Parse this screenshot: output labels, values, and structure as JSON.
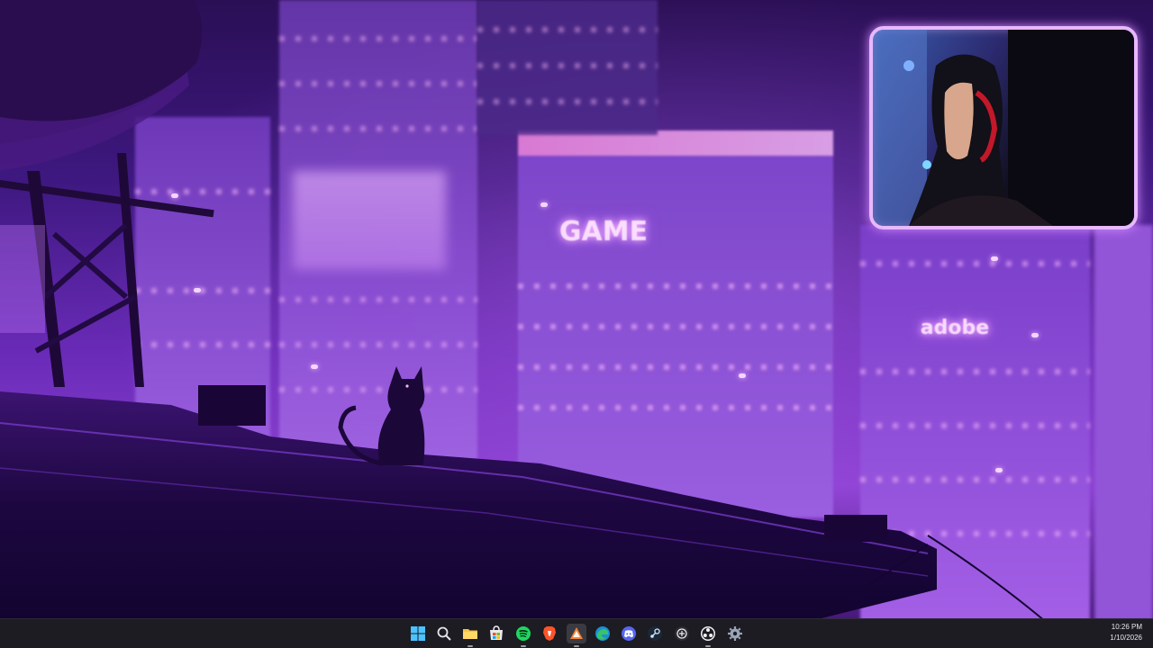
{
  "desktop": {
    "wallpaper_signs": {
      "game_sign": "GAME",
      "adobe_sign": "adobe"
    }
  },
  "webcam": {
    "label": "webcam-overlay"
  },
  "taskbar": {
    "icons": [
      {
        "name": "windows-start-icon",
        "label": "Start"
      },
      {
        "name": "search-icon",
        "label": "Search"
      },
      {
        "name": "file-explorer-icon",
        "label": "File Explorer"
      },
      {
        "name": "microsoft-store-icon",
        "label": "Microsoft Store"
      },
      {
        "name": "spotify-icon",
        "label": "Spotify"
      },
      {
        "name": "brave-browser-icon",
        "label": "Brave"
      },
      {
        "name": "affinity-designer-icon",
        "label": "Affinity"
      },
      {
        "name": "edge-browser-icon",
        "label": "Microsoft Edge"
      },
      {
        "name": "discord-icon",
        "label": "Discord"
      },
      {
        "name": "steam-icon",
        "label": "Steam"
      },
      {
        "name": "chatgpt-icon",
        "label": "ChatGPT"
      },
      {
        "name": "obs-studio-icon",
        "label": "OBS Studio"
      },
      {
        "name": "settings-gear-icon",
        "label": "Settings"
      }
    ],
    "clock": {
      "time": "10:26 PM",
      "date": "1/10/2026"
    }
  },
  "colors": {
    "accent_purple": "#8a3fd1",
    "webcam_border": "#e8b8ff",
    "taskbar_bg": "#1c1c22"
  }
}
